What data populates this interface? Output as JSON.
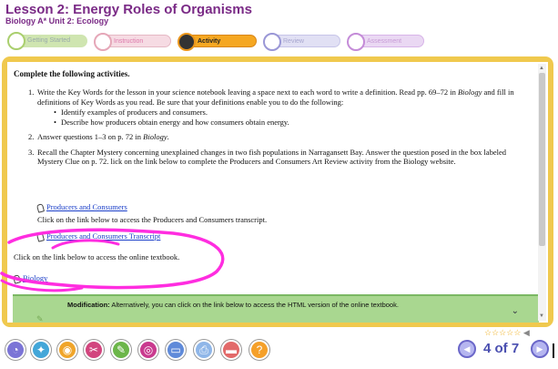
{
  "header": {
    "lesson_title": "Lesson 2: Energy Roles of Organisms",
    "course_unit": "Biology A*  Unit 2: Ecology"
  },
  "nav": {
    "tabs": [
      {
        "label": "Getting Started",
        "state": "done"
      },
      {
        "label": "Instruction",
        "state": "inactive"
      },
      {
        "label": "Activity",
        "state": "active"
      },
      {
        "label": "Review",
        "state": "inactive"
      },
      {
        "label": "Assessment",
        "state": "inactive"
      }
    ]
  },
  "content": {
    "heading": "Complete the following activities.",
    "items": [
      {
        "num": "1.",
        "text_parts": [
          "Write the Key Words for the lesson in your science notebook leaving a space next to each word to write a definition. Read pp. 69–72 in ",
          "Biology",
          " and fill in definitions of Key Words as you read. Be sure that your definitions enable you to do the following:"
        ]
      },
      {
        "num": "2.",
        "text_parts": [
          "Answer questions 1–3 on p. 72 in ",
          "Biology",
          "."
        ]
      },
      {
        "num": "3.",
        "text_parts": [
          "Recall the Chapter Mystery concerning unexplained changes in two fish populations in Narragansett Bay. Answer the question posed in the box labeled Mystery Clue on p. 72. lick on the link below to complete the Producers and Consumers Art Review activity from the Biology website."
        ]
      }
    ],
    "bullets": [
      "Identify examples of producers and consumers.",
      "Describe how producers obtain energy and how consumers obtain energy."
    ],
    "link1": "Producers and Consumers",
    "transcript_instruction": "Click on the link below to access the Producers and Consumers transcript.",
    "link2": "Producers and Consumers Transcript",
    "textbook_instruction": "Click on the link below to access the online textbook.",
    "link3": "Biology",
    "modification_label": "Modification:",
    "modification_text": " Alternatively, you can click on the link below to access the HTML version of the online textbook."
  },
  "footer": {
    "page_indicator": "4 of 7",
    "rating_stars": 5,
    "toolbar_icons": [
      "clock-icon",
      "ribbon-icon",
      "globe-icon",
      "tools-icon",
      "notes-icon",
      "target-icon",
      "screen-icon",
      "printer-icon",
      "drive-icon",
      "help-icon"
    ]
  },
  "colors": {
    "title": "#7a2a86",
    "panel_border": "#f0c94e",
    "link": "#1a3ec8",
    "modification_bg": "#a9d790",
    "annotation": "#ff2de0",
    "pager": "#4a4fb0"
  }
}
